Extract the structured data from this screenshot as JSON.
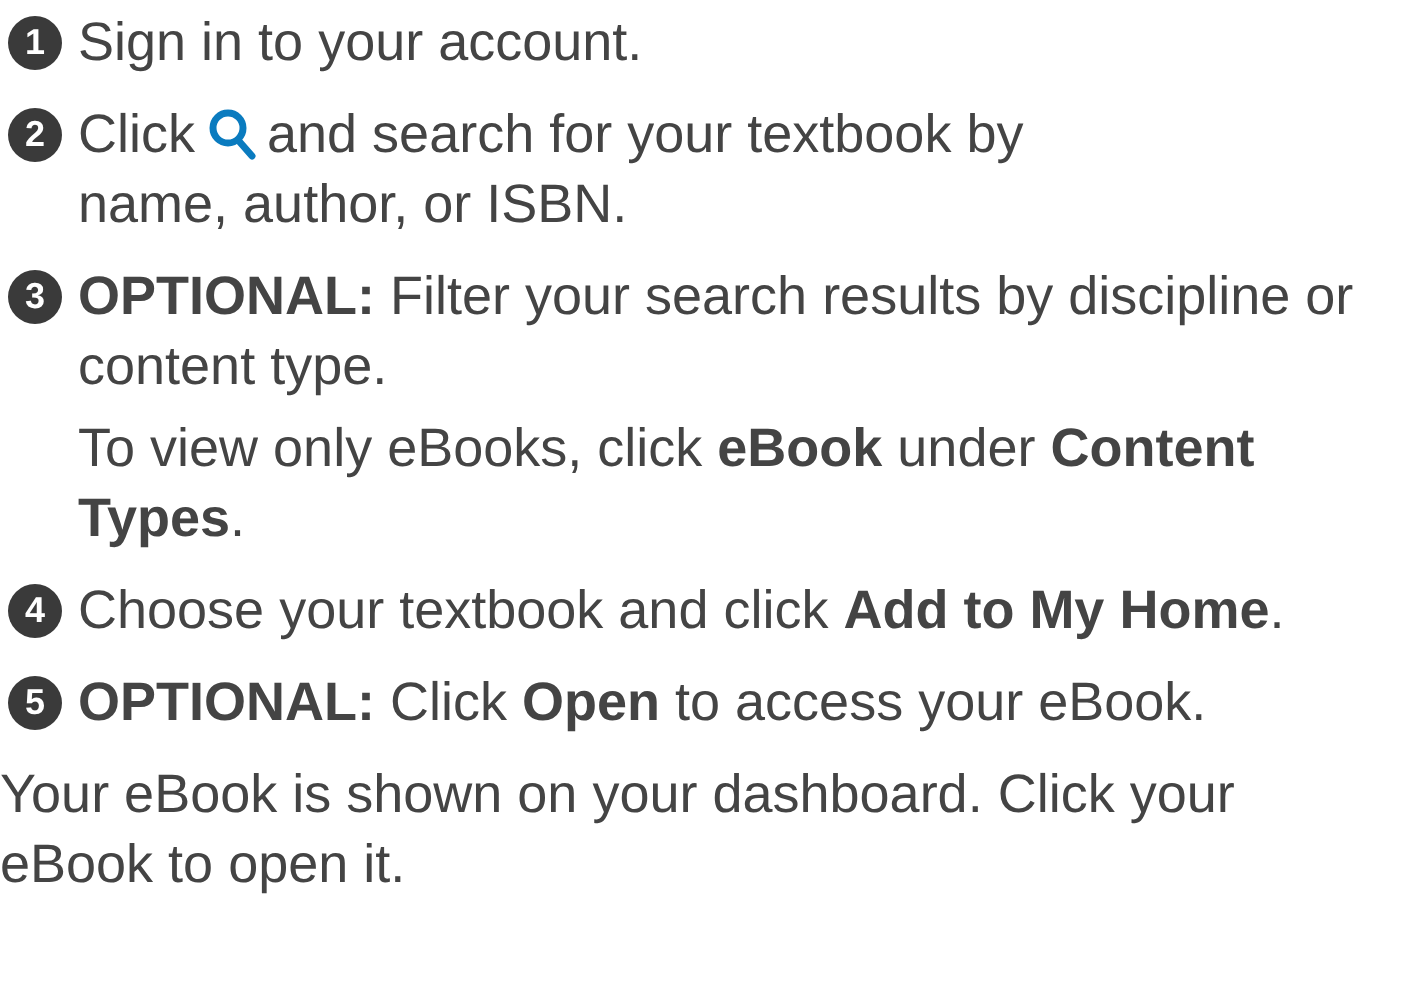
{
  "steps": [
    {
      "number": "1",
      "text": "Sign in to your  account."
    },
    {
      "number": "2",
      "text": "Click",
      "text_after_icon": "and search for your textbook by",
      "continuation": "name, author, or ISBN."
    },
    {
      "number": "3",
      "text": "**OPTIONAL:** Filter your search results by discipline or content type.",
      "note": "To view only eBooks, click **eBook** under **Content Types**."
    },
    {
      "number": "4",
      "text": "Choose your textbook and click **Add to My Home**."
    },
    {
      "number": "5",
      "text": "**OPTIONAL:** Click **Open** to access your eBook."
    }
  ],
  "footer": "Your eBook is shown on your dashboard. Click your eBook to open it."
}
